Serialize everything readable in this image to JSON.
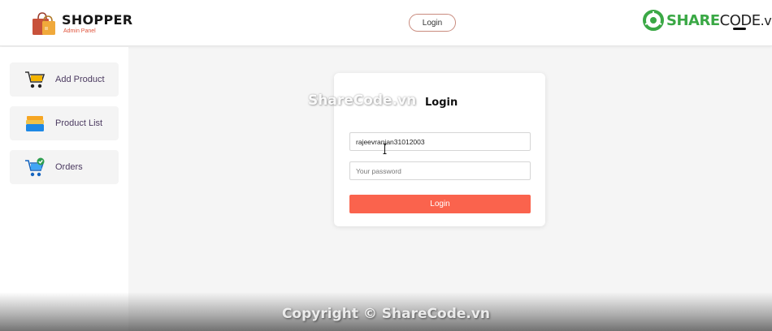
{
  "header": {
    "brand_title": "SHOPPER",
    "brand_subtitle": "Admin Panel",
    "login_button": "Login",
    "partner_logo": {
      "part1": "SHARE",
      "part2": "CODE",
      "part3": ".vn"
    }
  },
  "sidebar": {
    "items": [
      {
        "label": "Add Product",
        "icon": "cart-icon"
      },
      {
        "label": "Product List",
        "icon": "stack-icon"
      },
      {
        "label": "Orders",
        "icon": "cart-check-icon"
      }
    ]
  },
  "login_card": {
    "title": "Login",
    "username_value": "rajeevranjan31012003",
    "password_placeholder": "Your password",
    "submit_label": "Login"
  },
  "watermarks": {
    "center": "ShareCode.vn",
    "footer": "Copyright © ShareCode.vn"
  },
  "colors": {
    "accent": "#fa634d",
    "sidebar_text": "#4b3a60",
    "brand_sub": "#e0533b",
    "partner_green": "#3aa845"
  }
}
